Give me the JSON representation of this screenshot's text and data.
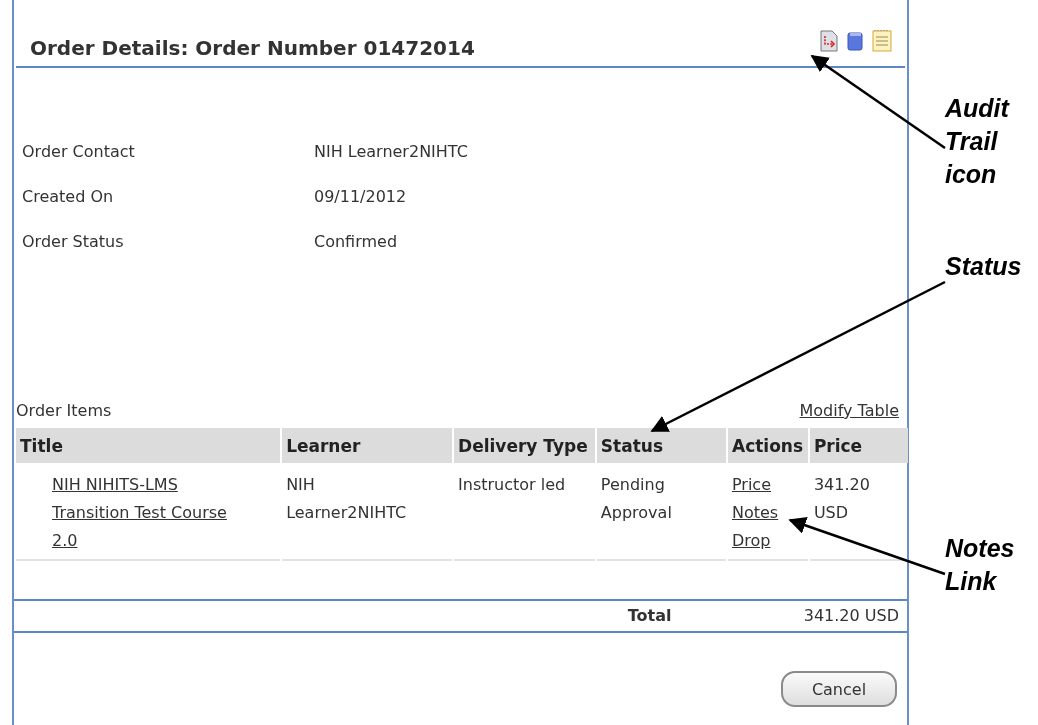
{
  "header": {
    "title": "Order Details: Order Number 01472014"
  },
  "fields": [
    {
      "label": "Order Contact",
      "value": "NIH Learner2NIHTC"
    },
    {
      "label": "Created On",
      "value": "09/11/2012"
    },
    {
      "label": "Order Status",
      "value": "Confirmed"
    }
  ],
  "order_items": {
    "title": "Order Items",
    "modify_link": "Modify Table",
    "columns": [
      "Title",
      "Learner",
      "Delivery Type",
      "Status",
      "Actions",
      "Price"
    ],
    "rows": [
      {
        "title": "NIH NIHITS-LMS Transition Test Course 2.0",
        "learner": "NIH Learner2NIHTC",
        "delivery_type": "Instructor led",
        "status": "Pending Approval",
        "actions": [
          "Price",
          "Notes",
          "Drop"
        ],
        "price": "341.20 USD"
      }
    ]
  },
  "total": {
    "label": "Total",
    "value": "341.20 USD"
  },
  "buttons": [
    "Cancel"
  ],
  "callouts": [
    {
      "text": "Audit Trail icon"
    },
    {
      "text": "Status"
    },
    {
      "text": "Notes Link"
    }
  ]
}
